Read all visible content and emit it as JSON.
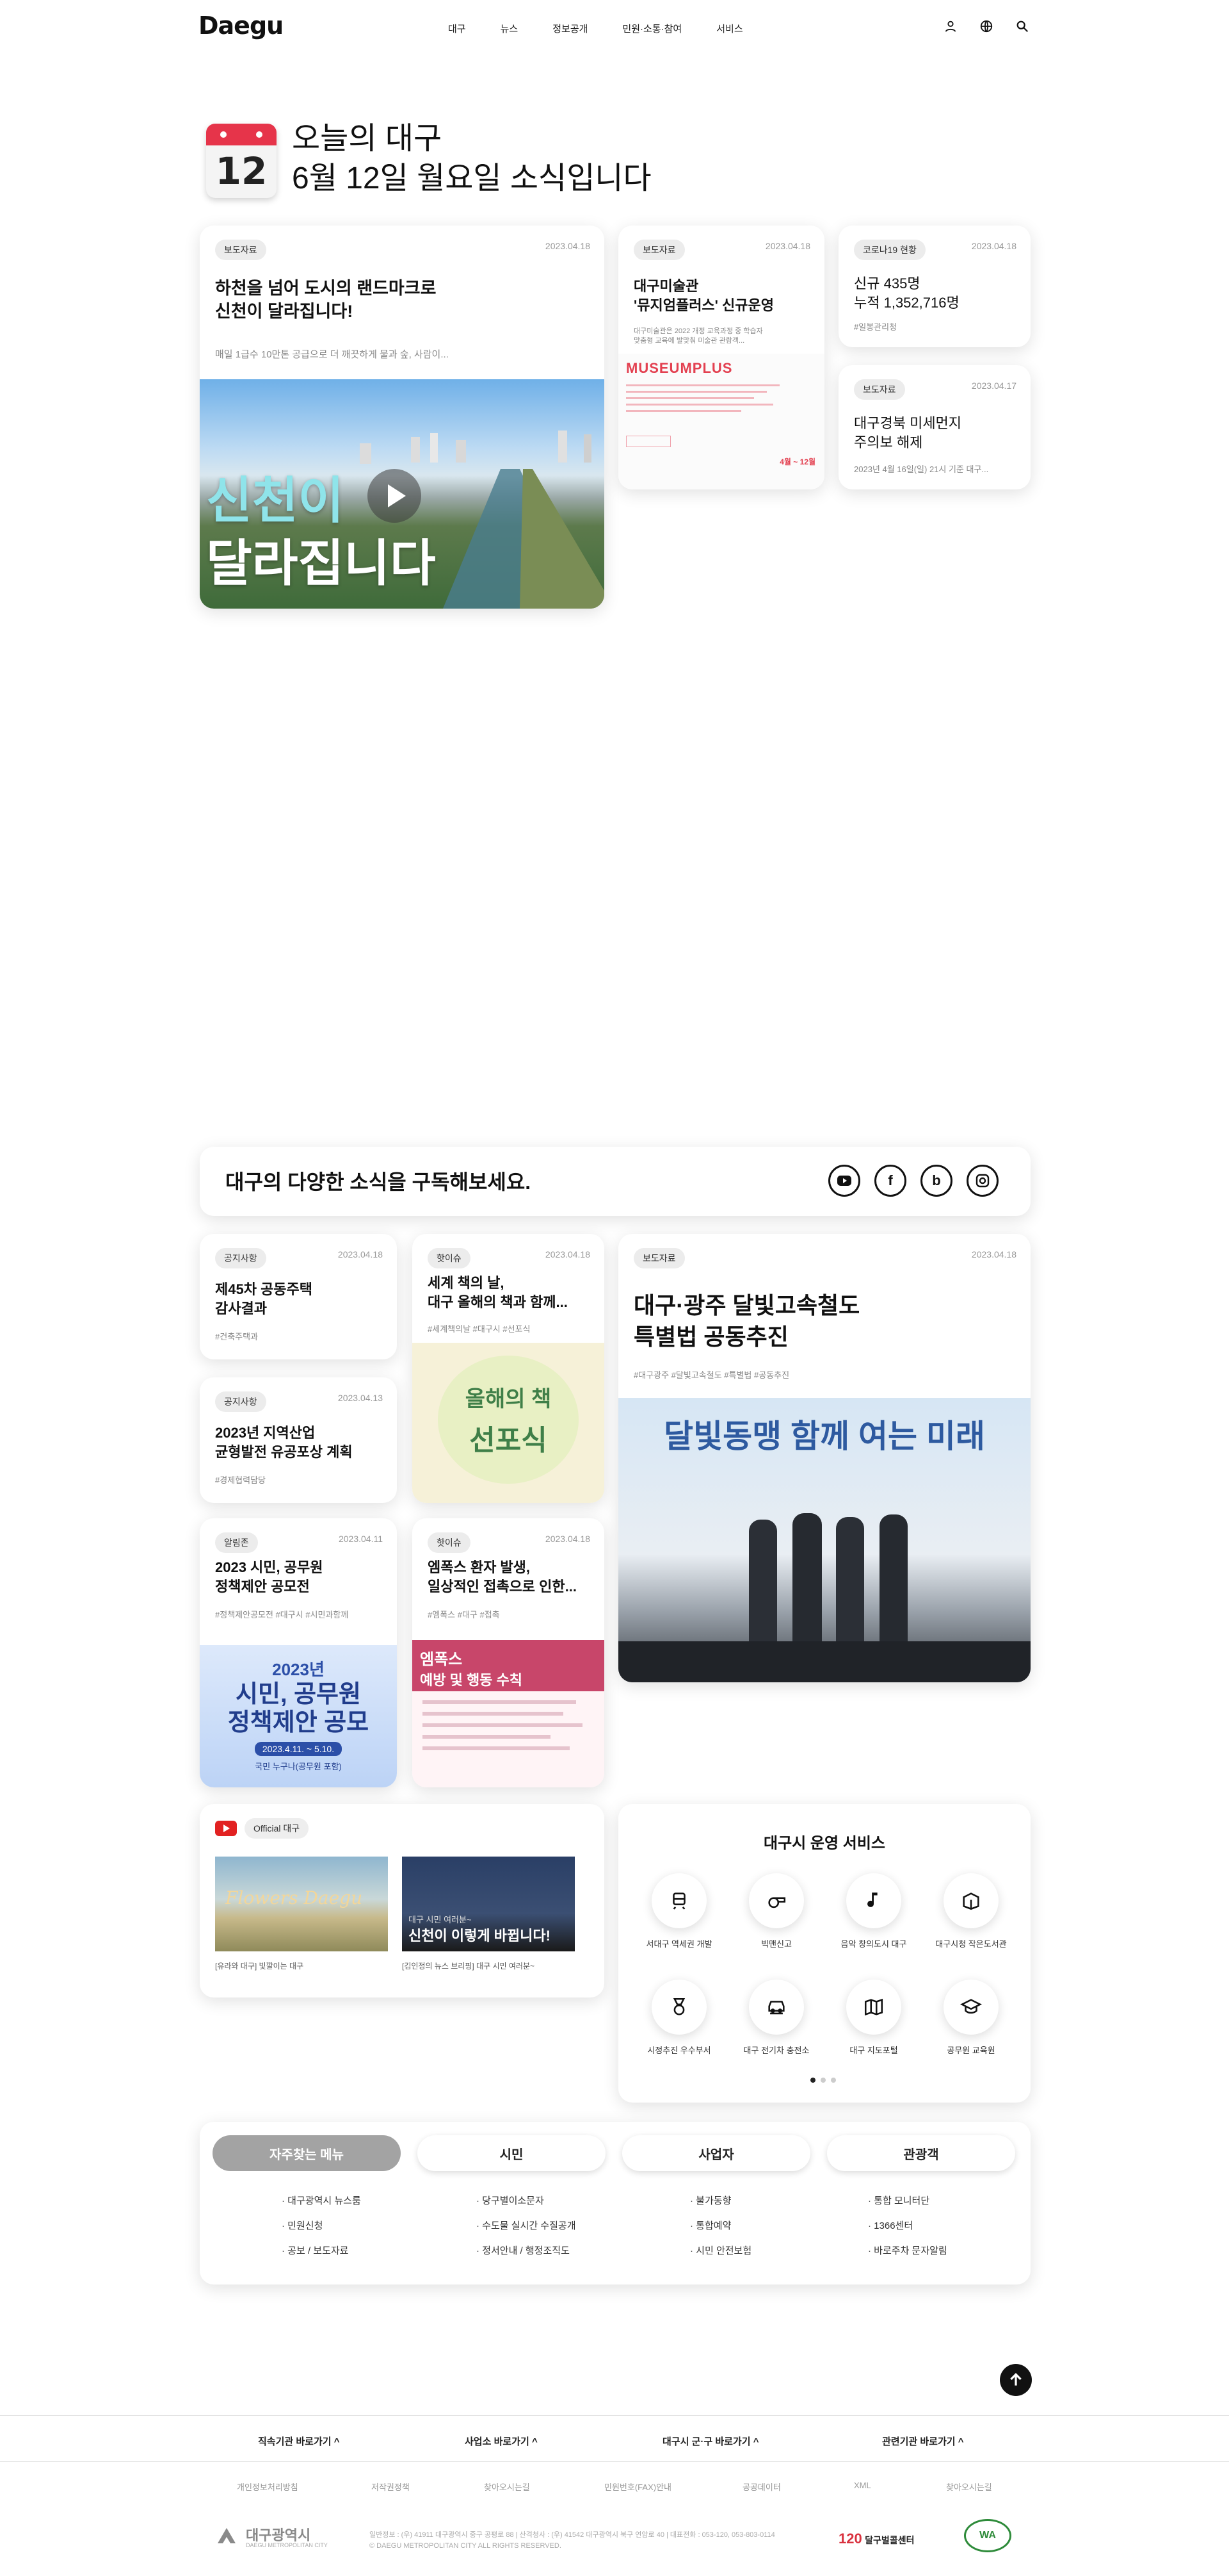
{
  "header": {
    "logo": "Daegu",
    "nav": [
      "대구",
      "뉴스",
      "정보공개",
      "민원·소통·참여",
      "서비스"
    ]
  },
  "today": {
    "day": "12",
    "line1": "오늘의 대구",
    "line2": "6월 12일 월요일 소식입니다"
  },
  "top_cards": {
    "main": {
      "badge": "보도자료",
      "date": "2023.04.18",
      "title1": "하천을 넘어 도시의 랜드마크로",
      "title2": "신천이 달라집니다!",
      "summary": "매일 1급수 10만톤 공급으로 더 깨끗하게 물과 숲, 사람이...",
      "image_text1": "신천이",
      "image_text2": "달라집니다"
    },
    "museum": {
      "badge": "보도자료",
      "date": "2023.04.18",
      "title1": "대구미술관",
      "title2": "'뮤지엄플러스' 신규운영",
      "summary1": "대구미술관은 2022 개정 교육과정 중 학습자",
      "summary2": "맞춤형 교육에 발맞춰 미술관 관람객...",
      "image_logo": "MUSEUMPLUS",
      "image_date": "4월 ~ 12월"
    },
    "covid": {
      "badge": "코로나19 현황",
      "date": "2023.04.18",
      "title1": "신규 435명",
      "title2": "누적 1,352,716명",
      "tag": "#일봉관리청"
    },
    "dust": {
      "badge": "보도자료",
      "date": "2023.04.17",
      "title1": "대구경북 미세먼지",
      "title2": "주의보 해제",
      "summary": "2023년 4월 16일(일) 21시 기준 대구..."
    }
  },
  "subscribe": {
    "title": "대구의 다양한 소식을 구독해보세요.",
    "icons": [
      "youtube-icon",
      "facebook-icon",
      "blog-icon",
      "instagram-icon"
    ]
  },
  "news": [
    {
      "badge": "공지사항",
      "date": "2023.04.18",
      "title1": "제45차 공동주택",
      "title2": "감사결과",
      "tags": "#건축주택과"
    },
    {
      "badge": "공지사항",
      "date": "2023.04.13",
      "title1": "2023년 지역산업",
      "title2": "균형발전 유공포상 계획",
      "tags": "#경제협력담당"
    },
    {
      "badge": "핫이슈",
      "date": "2023.04.18",
      "title1": "세계 책의 날,",
      "title2": "대구 올해의 책과 함께...",
      "tags": "#세계책의날 #대구시 #선포식",
      "image_text1": "올해의 책",
      "image_text2": "선포식"
    },
    {
      "badge": "알림존",
      "date": "2023.04.11",
      "title1": "2023 시민, 공무원",
      "title2": "정책제안 공모전",
      "tags": "#정책제안공모전 #대구시 #시민과함께",
      "image_text1": "2023년",
      "image_text2": "시민, 공무원",
      "image_text3": "정책제안 공모",
      "image_text4": "2023.4.11. ~ 5.10.",
      "image_text5": "국민 누구나(공무원 포함)"
    },
    {
      "badge": "핫이슈",
      "date": "2023.04.18",
      "title1": "엠폭스 환자 발생,",
      "title2": "일상적인 접촉으로 인한...",
      "tags": "#엠폭스 #대구 #접촉",
      "image_text1": "엠폭스",
      "image_text2": "예방 및 행동 수칙"
    },
    {
      "badge": "보도자료",
      "date": "2023.04.18",
      "title1": "대구·광주 달빛고속철도",
      "title2": "특별법 공동추진",
      "tags": "#대구광주 #달빛고속철도 #특별법 #공동추진",
      "image_text": "달빛동맹 함께 여는 미래"
    }
  ],
  "youtube": {
    "channel": "Official 대구",
    "videos": [
      {
        "caption": "[유라와 대구] 빛깔이는 대구",
        "thumb_text": "Flowers Daegu"
      },
      {
        "caption": "[김인정의 뉴스 브리핑] 대구 시민 여러분~",
        "thumb_text1": "대구 시민 여러분~",
        "thumb_text2": "신천이 이렇게 바뀝니다!"
      }
    ]
  },
  "services": {
    "title": "대구시 운영 서비스",
    "items": [
      {
        "label": "서대구 역세권 개발",
        "icon": "train-icon"
      },
      {
        "label": "빅맨신고",
        "icon": "whistle-icon"
      },
      {
        "label": "음악 창의도시 대구",
        "icon": "music-note-icon"
      },
      {
        "label": "대구시청 작은도서관",
        "icon": "book-icon"
      },
      {
        "label": "시정추진 우수부서",
        "icon": "medal-icon"
      },
      {
        "label": "대구 전기차 충전소",
        "icon": "car-icon"
      },
      {
        "label": "대구 지도포털",
        "icon": "map-icon"
      },
      {
        "label": "공무원 교육원",
        "icon": "graduation-cap-icon"
      }
    ]
  },
  "quick": {
    "tabs": [
      "자주찾는 메뉴",
      "시민",
      "사업자",
      "관광객"
    ],
    "links": [
      [
        "대구광역시 뉴스룸",
        "민원신청",
        "공보 / 보도자료"
      ],
      [
        "당구별이소문자",
        "수도물 실시간 수질공개",
        "정서안내 / 행정조직도"
      ],
      [
        "불가동향",
        "통합예약",
        "시민 안전보험"
      ],
      [
        "통합 모니터단",
        "1366센터",
        "바로주차 문자알림"
      ]
    ]
  },
  "footer": {
    "links": [
      "직속기관 바로가기",
      "사업소 바로가기",
      "대구시 군·구 바로가기",
      "관련기관 바로가기"
    ],
    "menu": [
      "개인정보처리방침",
      "저작권정책",
      "찾아오시는길",
      "민원번호(FAX)안내",
      "공공데이터",
      "XML",
      "찾아오시는길"
    ],
    "org": "대구광역시",
    "org_en": "DAEGU METROPOLITAN CITY",
    "address1": "일반정보 : (우) 41911 대구광역시 중구 공평로 88 | 산격청사 : (우) 41542 대구광역시 북구 연암로 40 | 대표전화 : 053-120, 053-803-0114",
    "address2": "© DAEGU METROPOLITAN CITY ALL RIGHTS RESERVED.",
    "call_center": "120 달구벌콜센터",
    "call_center_num": "120",
    "call_center_name": "달구벌콜센터",
    "wa_mark": "WA"
  }
}
